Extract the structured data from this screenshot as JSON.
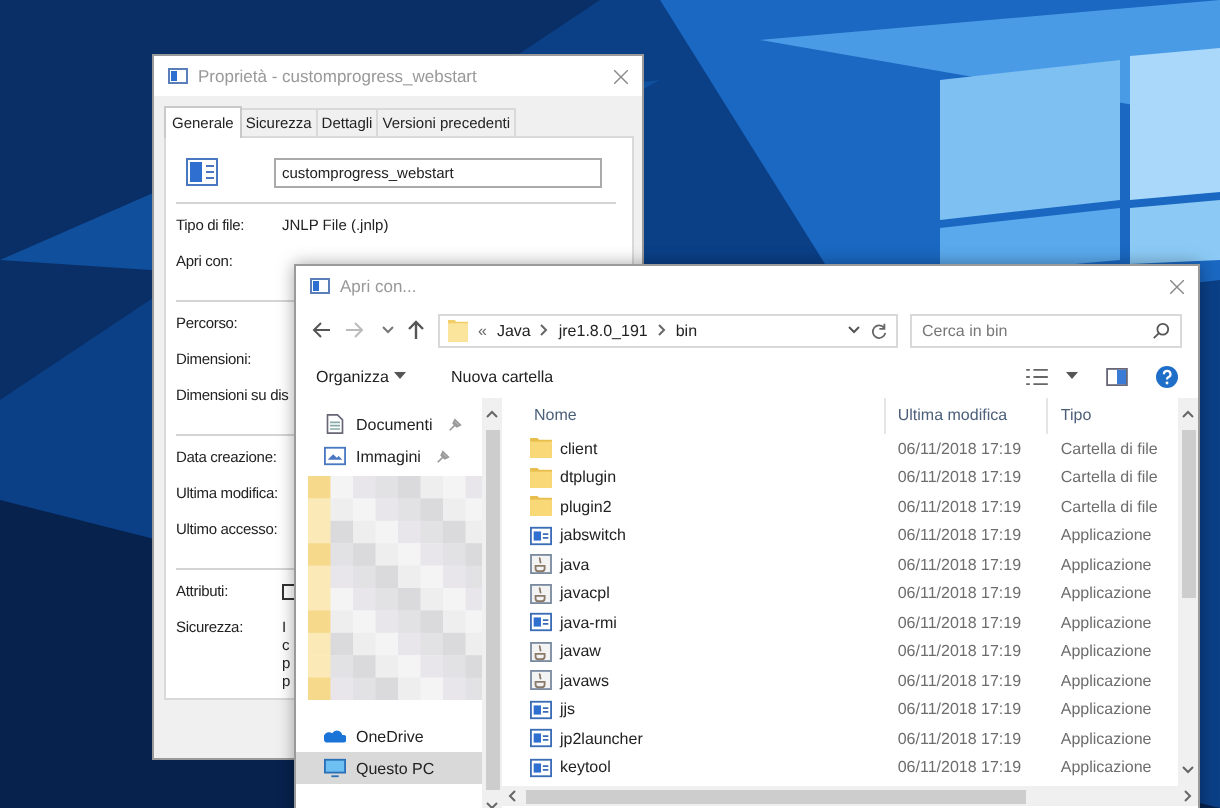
{
  "properties_window": {
    "title": "Proprietà - customprogress_webstart",
    "tabs": [
      {
        "label": "Generale",
        "selected": true
      },
      {
        "label": "Sicurezza",
        "selected": false
      },
      {
        "label": "Dettagli",
        "selected": false
      },
      {
        "label": "Versioni precedenti",
        "selected": false
      }
    ],
    "name_field": {
      "value": "customprogress_webstart"
    },
    "top_rows": [
      {
        "label": "Tipo di file:",
        "value": "JNLP File (.jnlp)"
      },
      {
        "label": "Apri con:"
      }
    ],
    "groups": [
      [
        {
          "label": "Percorso:"
        },
        {
          "label": "Dimensioni:"
        },
        {
          "label": "Dimensioni su dis"
        }
      ],
      [
        {
          "label": "Data creazione:"
        },
        {
          "label": "Ultima modifica:"
        },
        {
          "label": "Ultimo accesso:"
        }
      ],
      [
        {
          "label": "Attributi:",
          "kind": "checkbox",
          "checked": false
        },
        {
          "label": "Sicurezza:",
          "kind": "lines",
          "lines": [
            "I",
            "c",
            "p",
            "p"
          ]
        }
      ]
    ]
  },
  "open_with_window": {
    "title": "Apri con...",
    "breadcrumb": [
      "«",
      "Java",
      "jre1.8.0_191",
      "bin"
    ],
    "search": {
      "placeholder": "Cerca in bin"
    },
    "toolbar": {
      "organize": "Organizza",
      "new_folder": "Nuova cartella"
    },
    "quick_access": [
      {
        "label": "Documenti",
        "kind": "documents",
        "pinned": true
      },
      {
        "label": "Immagini",
        "kind": "pictures",
        "pinned": true
      }
    ],
    "locations": [
      {
        "label": "OneDrive",
        "kind": "cloud",
        "selected": false
      },
      {
        "label": "Questo PC",
        "kind": "pc",
        "selected": true
      }
    ],
    "columns": [
      "Nome",
      "Ultima modifica",
      "Tipo"
    ],
    "files": [
      {
        "name": "client",
        "modified": "06/11/2018 17:19",
        "type": "Cartella di file",
        "kind": "folder"
      },
      {
        "name": "dtplugin",
        "modified": "06/11/2018 17:19",
        "type": "Cartella di file",
        "kind": "folder"
      },
      {
        "name": "plugin2",
        "modified": "06/11/2018 17:19",
        "type": "Cartella di file",
        "kind": "folder"
      },
      {
        "name": "jabswitch",
        "modified": "06/11/2018 17:19",
        "type": "Applicazione",
        "kind": "app"
      },
      {
        "name": "java",
        "modified": "06/11/2018 17:19",
        "type": "Applicazione",
        "kind": "java"
      },
      {
        "name": "javacpl",
        "modified": "06/11/2018 17:19",
        "type": "Applicazione",
        "kind": "java"
      },
      {
        "name": "java-rmi",
        "modified": "06/11/2018 17:19",
        "type": "Applicazione",
        "kind": "app"
      },
      {
        "name": "javaw",
        "modified": "06/11/2018 17:19",
        "type": "Applicazione",
        "kind": "java"
      },
      {
        "name": "javaws",
        "modified": "06/11/2018 17:19",
        "type": "Applicazione",
        "kind": "java"
      },
      {
        "name": "jjs",
        "modified": "06/11/2018 17:19",
        "type": "Applicazione",
        "kind": "app"
      },
      {
        "name": "jp2launcher",
        "modified": "06/11/2018 17:19",
        "type": "Applicazione",
        "kind": "app"
      },
      {
        "name": "keytool",
        "modified": "06/11/2018 17:19",
        "type": "Applicazione",
        "kind": "app"
      }
    ]
  }
}
